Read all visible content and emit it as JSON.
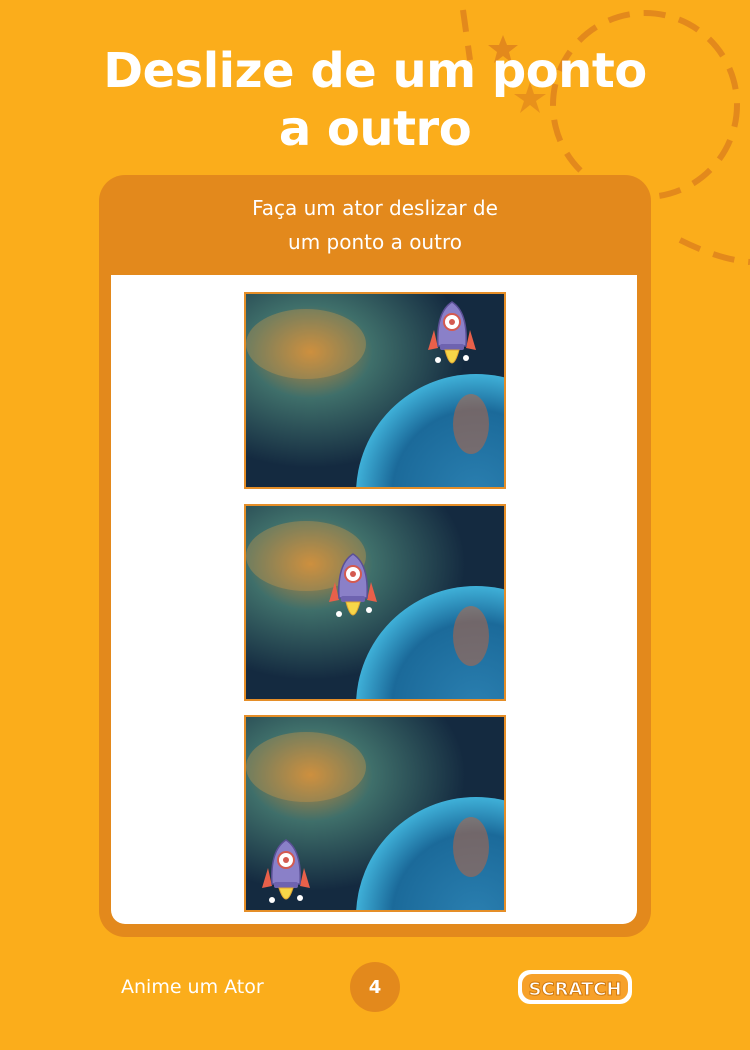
{
  "page": {
    "title_lines": [
      "Deslize de um ponto",
      "a outro"
    ],
    "background_color": "#fbad1b",
    "accent_color": "#e3891c"
  },
  "card": {
    "header_lines": [
      "Faça um ator deslizar de",
      "um ponto a outro"
    ],
    "scenes": [
      {
        "sprite": "rocket-sprite",
        "backdrop": "space-nebula",
        "rocket_position": "top-right"
      },
      {
        "sprite": "rocket-sprite",
        "backdrop": "space-nebula",
        "rocket_position": "middle-left"
      },
      {
        "sprite": "rocket-sprite",
        "backdrop": "space-nebula",
        "rocket_position": "bottom-left"
      }
    ]
  },
  "footer": {
    "left_text": "Anime um Ator",
    "page_number": "4",
    "logo_text": "SCRATCH"
  }
}
